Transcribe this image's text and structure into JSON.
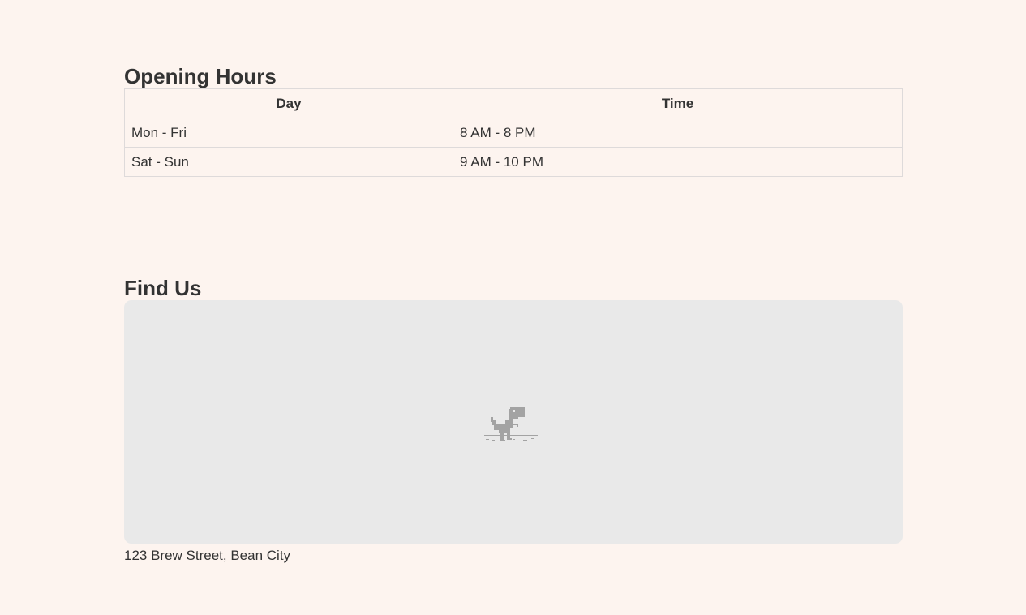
{
  "hours": {
    "title": "Opening Hours",
    "columns": [
      "Day",
      "Time"
    ],
    "rows": [
      [
        "Mon - Fri",
        "8 AM - 8 PM"
      ],
      [
        "Sat - Sun",
        "9 AM - 10 PM"
      ]
    ]
  },
  "location": {
    "title": "Find Us",
    "map_placeholder_icon": "offline-dino-icon",
    "address": "123 Brew Street, Bean City"
  }
}
